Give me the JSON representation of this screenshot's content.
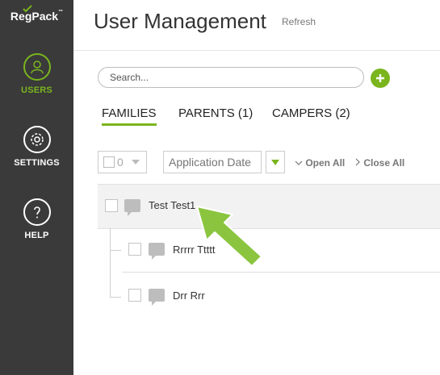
{
  "sidebar": {
    "logo": "RegPack",
    "logo_tm": "™",
    "items": [
      {
        "label": "USERS",
        "icon": "user-icon",
        "active": true
      },
      {
        "label": "SETTINGS",
        "icon": "gear-icon",
        "active": false
      },
      {
        "label": "HELP",
        "icon": "question-icon",
        "active": false
      }
    ]
  },
  "header": {
    "title": "User Management",
    "refresh": "Refresh"
  },
  "search": {
    "placeholder": "Search...",
    "value": ""
  },
  "tabs": [
    {
      "label": "FAMILIES",
      "active": true
    },
    {
      "label": "PARENTS (1)",
      "active": false
    },
    {
      "label": "CAMPERS (2)",
      "active": false
    }
  ],
  "toolbar": {
    "selected_count": "0",
    "date_placeholder": "Application Date",
    "open_all": "Open All",
    "close_all": "Close All"
  },
  "list": {
    "family": {
      "name": "Test Test1"
    },
    "members": [
      {
        "name": "Rrrrr Ttttt"
      },
      {
        "name": "Drr Rrr"
      }
    ]
  },
  "colors": {
    "accent": "#7ab51d",
    "sidebar_bg": "#3a3a3a",
    "row_highlight": "#f2f2f2"
  }
}
